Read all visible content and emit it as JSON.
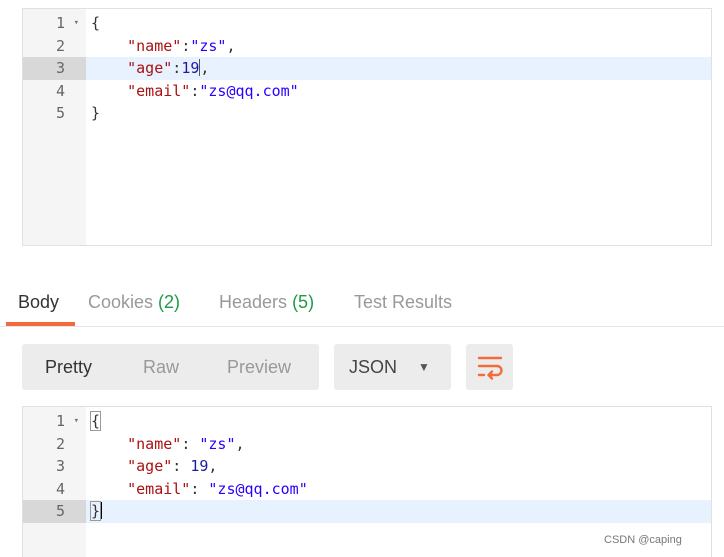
{
  "request_editor": {
    "lines": [
      {
        "num": "1",
        "fold": "▾",
        "text": "{"
      },
      {
        "num": "2",
        "key": "\"name\"",
        "sep": ":",
        "value": "\"zs\"",
        "tail": ","
      },
      {
        "num": "3",
        "key": "\"age\"",
        "sep": ":",
        "value": "19",
        "tail": ","
      },
      {
        "num": "4",
        "key": "\"email\"",
        "sep": ":",
        "value": "\"zs@qq.com\"",
        "tail": ""
      },
      {
        "num": "5",
        "text": "}"
      }
    ]
  },
  "response_tabs": {
    "body": "Body",
    "cookies": "Cookies",
    "cookies_count": "(2)",
    "headers": "Headers",
    "headers_count": "(5)",
    "tests": "Test Results"
  },
  "view_modes": {
    "pretty": "Pretty",
    "raw": "Raw",
    "preview": "Preview"
  },
  "format_select": {
    "value": "JSON",
    "caret": "▼"
  },
  "response_editor": {
    "lines": [
      {
        "num": "1",
        "fold": "▾",
        "text": "{"
      },
      {
        "num": "2",
        "key": "\"name\"",
        "sep": ": ",
        "value": "\"zs\"",
        "tail": ","
      },
      {
        "num": "3",
        "key": "\"age\"",
        "sep": ": ",
        "value": "19",
        "tail": ","
      },
      {
        "num": "4",
        "key": "\"email\"",
        "sep": ": ",
        "value": "\"zs@qq.com\"",
        "tail": ""
      },
      {
        "num": "5",
        "text": "}"
      }
    ]
  },
  "colors": {
    "accent": "#f26b3a",
    "count": "#1e9a46",
    "key": "#aa1111",
    "string": "#2a00ff",
    "number": "#1a1aa6",
    "active_line": "#e8f2fe"
  },
  "watermark": "CSDN @caping"
}
